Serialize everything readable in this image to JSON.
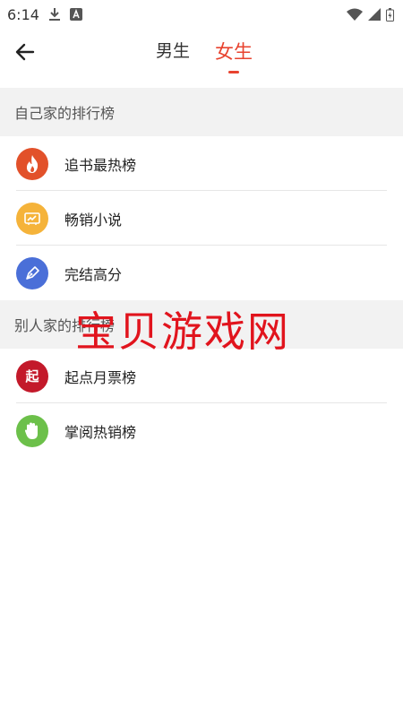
{
  "status_bar": {
    "time": "6:14",
    "icons": [
      "download-icon",
      "app-a-icon",
      "wifi-icon",
      "signal-icon",
      "battery-icon"
    ]
  },
  "header": {
    "back_icon": "back-arrow-icon",
    "tabs": [
      {
        "label": "男生",
        "active": false
      },
      {
        "label": "女生",
        "active": true
      }
    ],
    "accent_color": "#e8432f"
  },
  "sections": [
    {
      "title": "自己家的排行榜",
      "items": [
        {
          "label": "追书最热榜",
          "icon": "flame-icon",
          "color": "#e2512a"
        },
        {
          "label": "畅销小说",
          "icon": "book-chart-icon",
          "color": "#f5b33a"
        },
        {
          "label": "完结高分",
          "icon": "pen-icon",
          "color": "#4a6fd8"
        }
      ]
    },
    {
      "title": "别人家的排行榜",
      "items": [
        {
          "label": "起点月票榜",
          "icon": "qidian-logo-icon",
          "color": "#c3192a",
          "glyph": "起"
        },
        {
          "label": "掌阅热销榜",
          "icon": "palm-icon",
          "color": "#6cc04a"
        }
      ]
    }
  ],
  "watermark": "宝贝游戏网"
}
